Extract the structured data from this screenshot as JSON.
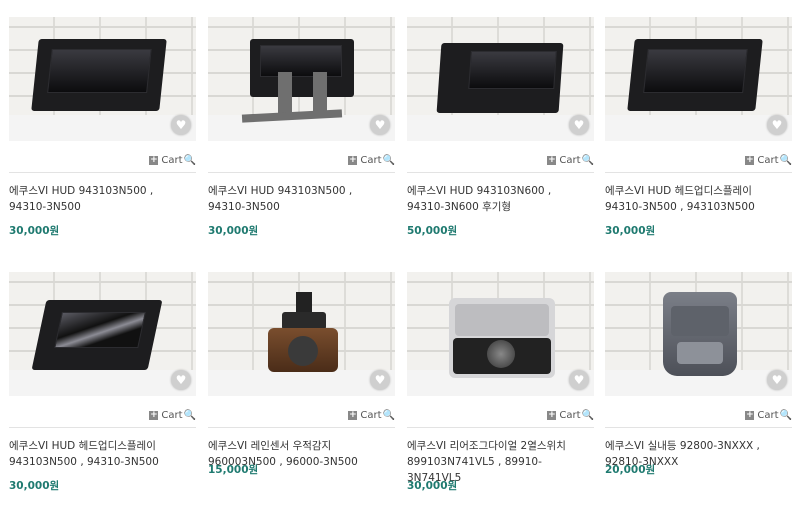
{
  "currency_suffix": "원",
  "cart_label": "Cart",
  "products": [
    {
      "title_line1": "에쿠스VI HUD 943103N500 ,",
      "title_line2": "94310-3N500",
      "title_line3": "",
      "price": "30,000원"
    },
    {
      "title_line1": "에쿠스VI HUD 943103N500 ,",
      "title_line2": "94310-3N500",
      "title_line3": "",
      "price": "30,000원"
    },
    {
      "title_line1": "에쿠스VI HUD 943103N600 ,",
      "title_line2": "94310-3N600 후기형",
      "title_line3": "",
      "price": "50,000원"
    },
    {
      "title_line1": "에쿠스VI HUD 헤드업디스플레이",
      "title_line2": "94310-3N500 , 943103N500",
      "title_line3": "",
      "price": "30,000원"
    },
    {
      "title_line1": "에쿠스VI HUD 헤드업디스플레이",
      "title_line2": "943103N500 , 94310-3N500",
      "title_line3": "",
      "price": "30,000원"
    },
    {
      "title_line1": "에쿠스VI 레인센서 우적감지",
      "title_line2": "960003N500 , 96000-3N500",
      "title_line3": "",
      "price": "15,000원"
    },
    {
      "title_line1": "에쿠스VI 리어조그다이얼 2열스위치",
      "title_line2": "899103N741VL5 , 89910-",
      "title_line3": "3N741VL5",
      "price": "30,000원"
    },
    {
      "title_line1": "에쿠스VI 실내등 92800-3NXXX ,",
      "title_line2": "92810-3NXXX",
      "title_line3": "",
      "price": "20,000원"
    }
  ]
}
